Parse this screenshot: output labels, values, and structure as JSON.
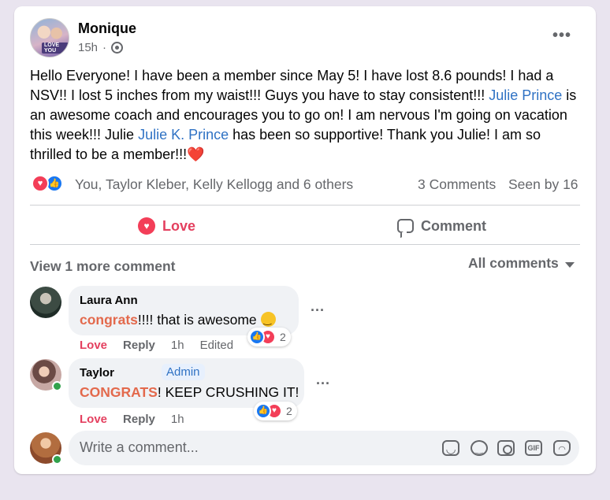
{
  "post": {
    "author": "Monique",
    "avatar_badge": "LOVE YOU",
    "time": "15h",
    "audience_icon": "friends-globe-icon",
    "text_parts": {
      "p1": "Hello Everyone! I have been a member since May 5! I have lost 8.6 pounds! I had a NSV!! I lost 5 inches from my waist!!! Guys you have to stay consistent!!! ",
      "mention1": "Julie Prince",
      "p2": " is an awesome coach and encourages you to go on! I am nervous I'm going on vacation this week!!! Julie ",
      "mention2": "Julie K. Prince",
      "p3": " has been so supportive! Thank you Julie! I am so thrilled to be a member!!!",
      "heart": "❤️"
    }
  },
  "reactions": {
    "icons": [
      "love-reaction-icon",
      "like-reaction-icon"
    ],
    "names": "You, Taylor Kleber, Kelly Kellogg and 6 others",
    "comments": "3 Comments",
    "seen": "Seen by 16"
  },
  "actions": {
    "love_label": "Love",
    "comment_label": "Comment"
  },
  "comments_header": {
    "view_more": "View 1 more comment",
    "filter": "All comments"
  },
  "comments": [
    {
      "name": "Laura Ann",
      "highlight": "congrats",
      "text": "!!!! that is awesome ",
      "emoji": "slightly-smiling-face",
      "love": "Love",
      "reply": "Reply",
      "time": "1h",
      "edited": "Edited",
      "reaction_count": "2"
    },
    {
      "name": "Taylor",
      "badge": "Admin",
      "highlight": "CONGRATS",
      "text": "! KEEP CRUSHING IT!",
      "love": "Love",
      "reply": "Reply",
      "time": "1h",
      "reaction_count": "2"
    }
  ],
  "composer": {
    "placeholder": "Write a comment...",
    "tools": [
      "sticker-icon",
      "emoji-icon",
      "camera-icon",
      "gif-icon",
      "avatar-sticker-icon"
    ]
  },
  "colors": {
    "love": "#e4405f",
    "mention": "#2f72c4",
    "highlight": "#e3694c",
    "muted": "#65676b"
  }
}
